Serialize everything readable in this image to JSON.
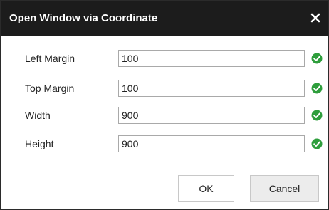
{
  "dialog": {
    "title": "Open Window via Coordinate",
    "close_icon": "close-icon"
  },
  "fields": [
    {
      "label": "Left Margin",
      "value": "100",
      "status_icon": "check-circle-icon"
    },
    {
      "label": "Top Margin",
      "value": "100",
      "status_icon": "check-circle-icon"
    },
    {
      "label": "Width",
      "value": "900",
      "status_icon": "check-circle-icon"
    },
    {
      "label": "Height",
      "value": "900",
      "status_icon": "check-circle-icon"
    }
  ],
  "buttons": {
    "ok_label": "OK",
    "cancel_label": "Cancel"
  },
  "colors": {
    "titlebar": "#1c1c1c",
    "valid_check": "#2e9e3c"
  }
}
